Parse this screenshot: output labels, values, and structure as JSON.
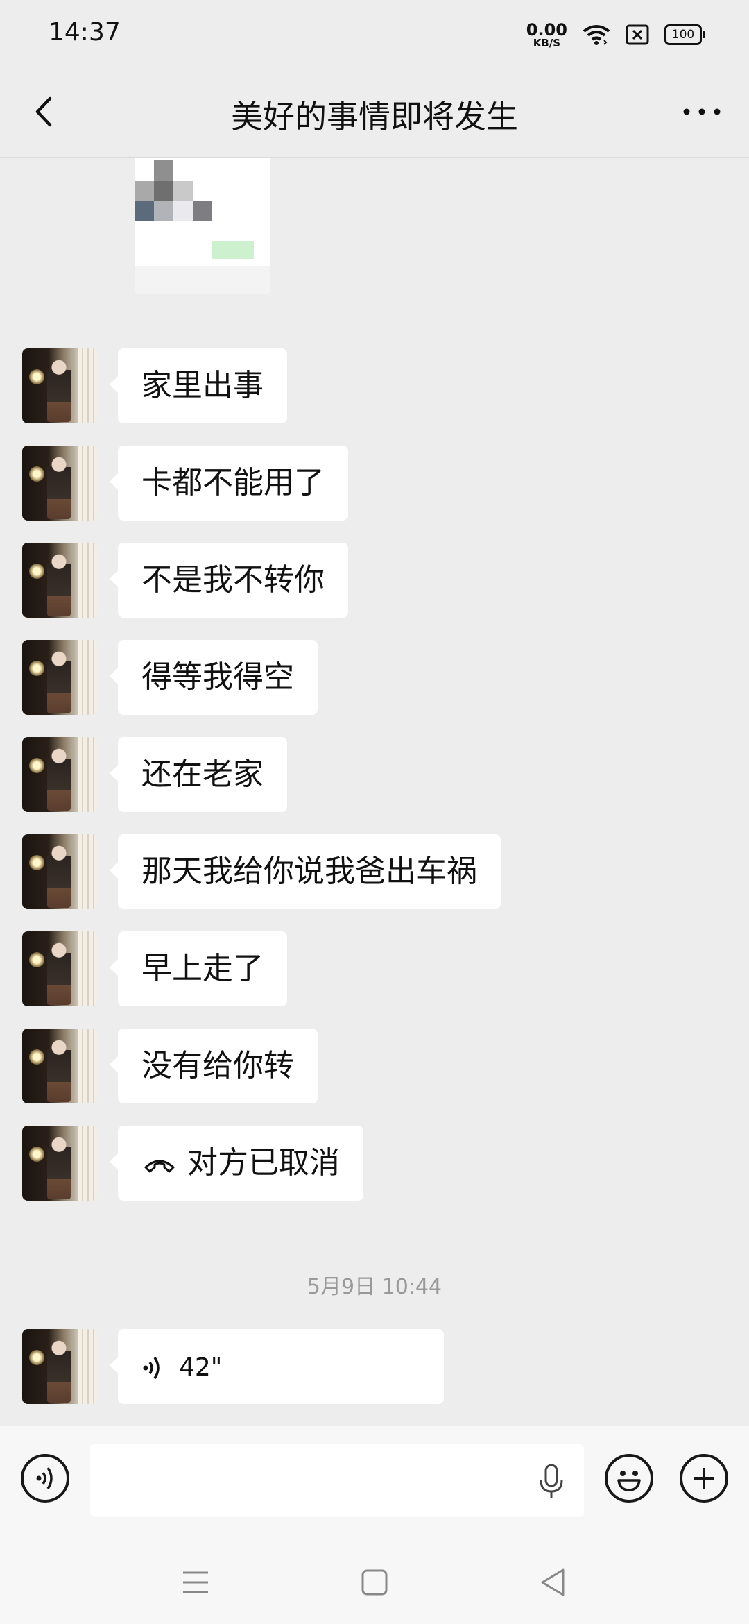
{
  "status_bar": {
    "time": "14:37",
    "net_speed_value": "0.00",
    "net_speed_unit": "KB/S",
    "battery": "100"
  },
  "header": {
    "title": "美好的事情即将发生"
  },
  "messages": [
    {
      "text": "家里出事"
    },
    {
      "text": "卡都不能用了"
    },
    {
      "text": "不是我不转你"
    },
    {
      "text": "得等我得空"
    },
    {
      "text": "还在老家"
    },
    {
      "text": "那天我给你说我爸出车祸"
    },
    {
      "text": "早上走了"
    },
    {
      "text": "没有给你转"
    },
    {
      "text": "对方已取消",
      "icon": "hang-up-icon"
    }
  ],
  "timestamp": "5月9日 10:44",
  "voice_message": {
    "duration": "42\"",
    "icon": "voice-wave-icon"
  },
  "input_bar": {
    "placeholder": "",
    "left_icon": "voice-mode-icon",
    "mic_icon": "microphone-icon",
    "emoji_icon": "emoji-icon",
    "plus_icon": "plus-icon"
  },
  "system_nav": {
    "menu_icon": "menu-icon",
    "home_icon": "home-icon",
    "back_icon": "back-triangle-icon"
  }
}
